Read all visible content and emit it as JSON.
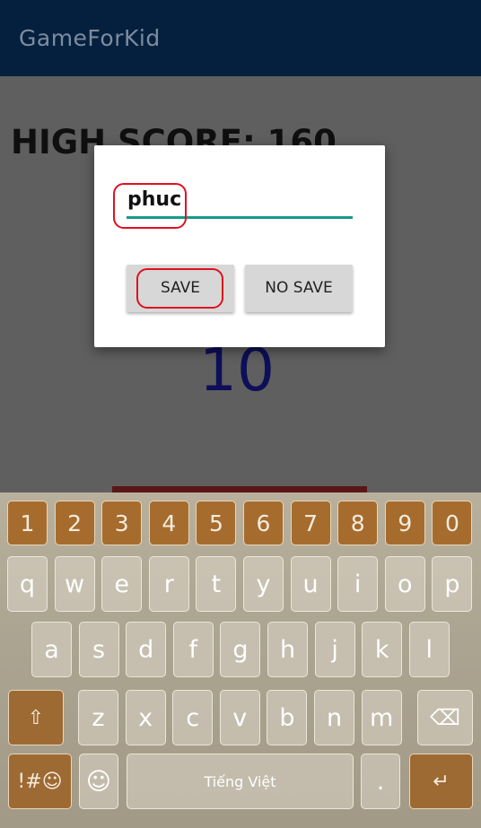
{
  "app_bar": {
    "title": "GameForKid"
  },
  "game": {
    "high_score_text": "HIGH SCORE: 160",
    "current_score": "10"
  },
  "dialog": {
    "input_value": "phuc",
    "save_label": "SAVE",
    "no_save_label": "NO SAVE"
  },
  "keyboard": {
    "numbers": [
      "1",
      "2",
      "3",
      "4",
      "5",
      "6",
      "7",
      "8",
      "9",
      "0"
    ],
    "row1": [
      "q",
      "w",
      "e",
      "r",
      "t",
      "y",
      "u",
      "i",
      "o",
      "p"
    ],
    "row2": [
      "a",
      "s",
      "d",
      "f",
      "g",
      "h",
      "j",
      "k",
      "l"
    ],
    "row3": [
      "z",
      "x",
      "c",
      "v",
      "b",
      "n",
      "m"
    ],
    "shift_icon": "⇧",
    "backspace_icon": "⌫",
    "symbols_label": "!#☺",
    "emoji_icon": "☺",
    "space_label": "Tiếng Việt",
    "period_label": ".",
    "enter_icon": "↵"
  },
  "colors": {
    "appbar": "#05203f",
    "accent": "#139b89",
    "highlight": "#e01020",
    "key_dark": "#a66c2e"
  }
}
